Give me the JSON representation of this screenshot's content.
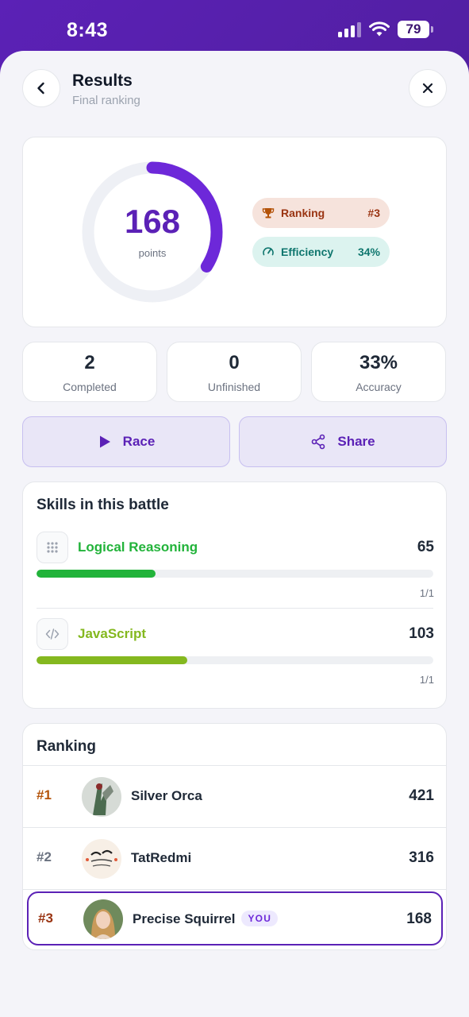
{
  "status": {
    "time": "8:43",
    "battery": "79"
  },
  "header": {
    "title": "Results",
    "subtitle": "Final ranking"
  },
  "score": {
    "value": "168",
    "unit": "points",
    "progress": 0.34
  },
  "pills": {
    "ranking_label": "Ranking",
    "ranking_value": "#3",
    "efficiency_label": "Efficiency",
    "efficiency_value": "34%"
  },
  "stats": [
    {
      "value": "2",
      "label": "Completed"
    },
    {
      "value": "0",
      "label": "Unfinished"
    },
    {
      "value": "33%",
      "label": "Accuracy"
    }
  ],
  "actions": {
    "race_label": "Race",
    "share_label": "Share"
  },
  "skills": {
    "title": "Skills in this battle",
    "items": [
      {
        "name": "Logical Reasoning",
        "score": "65",
        "fraction": "1/1",
        "progress": 0.3,
        "color": "#22b33a",
        "icon": "grid-dots-icon"
      },
      {
        "name": "JavaScript",
        "score": "103",
        "fraction": "1/1",
        "progress": 0.38,
        "color": "#84b81f",
        "icon": "code-icon"
      }
    ]
  },
  "ranking": {
    "title": "Ranking",
    "rows": [
      {
        "position": "#1",
        "name": "Silver Orca",
        "score": "421"
      },
      {
        "position": "#2",
        "name": "TatRedmi",
        "score": "316"
      },
      {
        "position": "#3",
        "name": "Precise Squirrel",
        "score": "168",
        "badge": "YOU"
      }
    ]
  },
  "colors": {
    "accent": "#5b21b6",
    "gold": "#b45309",
    "bronze": "#9a3412"
  }
}
